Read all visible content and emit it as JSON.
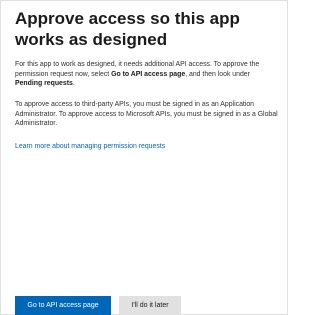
{
  "dialog": {
    "title": "Approve access so this app works as designed",
    "paragraph1": {
      "text_before": "For this app to work as designed, it needs additional API access. To approve the permission request now, select ",
      "bold_1": "Go to API access page",
      "text_middle": ", and then look under ",
      "bold_2": "Pending requests",
      "text_after": "."
    },
    "paragraph2": "To approve access to third-party APIs, you must be signed in as an Application Administrator. To approve access to Microsoft APIs, you must be signed in as a Global Administrator.",
    "learn_more_link": "Learn more about managing permission requests",
    "buttons": {
      "primary_label": "Go to API access page",
      "secondary_label": "I'll do it later"
    }
  },
  "colors": {
    "primary": "#0067b8",
    "link": "#0067b8",
    "secondary_button_bg": "#e1e1e1",
    "text": "#323130"
  }
}
